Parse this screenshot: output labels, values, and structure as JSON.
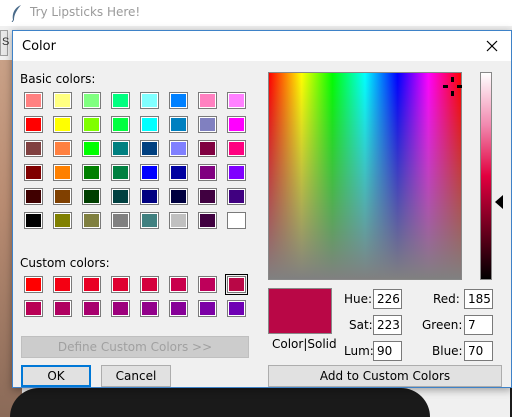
{
  "background_app": {
    "title": "Try Lipsticks Here!",
    "strip_letter": "S"
  },
  "dialog": {
    "title": "Color",
    "basic_colors_label": "Basic colors:",
    "custom_colors_label": "Custom colors:",
    "define_button": "Define Custom Colors >>",
    "ok_button": "OK",
    "cancel_button": "Cancel",
    "add_button": "Add to Custom Colors",
    "colorsolid_label": "Color|Solid",
    "fields": {
      "hue": {
        "label": "Hue:",
        "value": "226"
      },
      "sat": {
        "label": "Sat:",
        "value": "223"
      },
      "lum": {
        "label": "Lum:",
        "value": "90"
      },
      "red": {
        "label": "Red:",
        "value": "185"
      },
      "green": {
        "label": "Green:",
        "value": "7"
      },
      "blue": {
        "label": "Blue:",
        "value": "70"
      }
    },
    "current_color": "#b90746",
    "basic_colors": [
      [
        "#ff8080",
        "#ffff80",
        "#80ff80",
        "#00ff80",
        "#80ffff",
        "#0080ff",
        "#ff80c0",
        "#ff80ff"
      ],
      [
        "#ff0000",
        "#ffff00",
        "#80ff00",
        "#00ff40",
        "#00ffff",
        "#0080c0",
        "#8080c0",
        "#ff00ff"
      ],
      [
        "#804040",
        "#ff8040",
        "#00ff00",
        "#008080",
        "#004080",
        "#8080ff",
        "#800040",
        "#ff0080"
      ],
      [
        "#800000",
        "#ff8000",
        "#008000",
        "#008040",
        "#0000ff",
        "#0000a0",
        "#800080",
        "#8000ff"
      ],
      [
        "#400000",
        "#804000",
        "#004000",
        "#004040",
        "#000080",
        "#000040",
        "#400040",
        "#400080"
      ],
      [
        "#000000",
        "#808000",
        "#808040",
        "#808080",
        "#408080",
        "#c0c0c0",
        "#400040",
        "#ffffff"
      ]
    ],
    "custom_colors": [
      [
        "#ff0000",
        "#f40012",
        "#e90024",
        "#df0030",
        "#d4003c",
        "#c9004c",
        "#be005a",
        "#b90746"
      ],
      [
        "#b90055",
        "#b00060",
        "#a8006e",
        "#9d007c",
        "#92008a",
        "#870098",
        "#7c00a6",
        "#6f00b4"
      ]
    ]
  }
}
